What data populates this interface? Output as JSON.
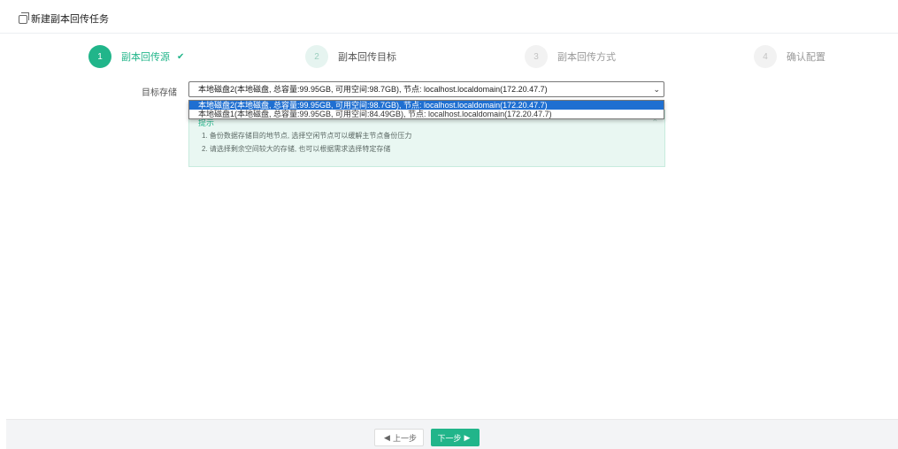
{
  "header": {
    "title": "新建副本回传任务",
    "icon": "copy-icon"
  },
  "steps": [
    {
      "number": "1",
      "label": "副本回传源",
      "state": "active",
      "check": "✔"
    },
    {
      "number": "2",
      "label": "副本回传目标",
      "state": "next"
    },
    {
      "number": "3",
      "label": "副本回传方式",
      "state": "idle"
    },
    {
      "number": "4",
      "label": "确认配置",
      "state": "idle"
    }
  ],
  "form": {
    "label": "目标存储",
    "selected": "本地磁盘2(本地磁盘, 总容量:99.95GB, 可用空间:98.7GB), 节点: localhost.localdomain(172.20.47.7)",
    "options": [
      "本地磁盘2(本地磁盘, 总容量:99.95GB, 可用空间:98.7GB), 节点: localhost.localdomain(172.20.47.7)",
      "本地磁盘1(本地磁盘, 总容量:99.95GB, 可用空间:84.49GB), 节点: localhost.localdomain(172.20.47.7)"
    ]
  },
  "tip": {
    "heading": "提示",
    "lines": [
      "1. 备份数据存储目的地节点, 选择空闲节点可以缓解主节点备份压力",
      "2. 请选择剩余空间较大的存储, 也可以根据需求选择特定存储"
    ]
  },
  "footer": {
    "prev": "上一步",
    "next": "下一步"
  },
  "colors": {
    "accent": "#21b58a",
    "selection": "#1f6fd1"
  }
}
